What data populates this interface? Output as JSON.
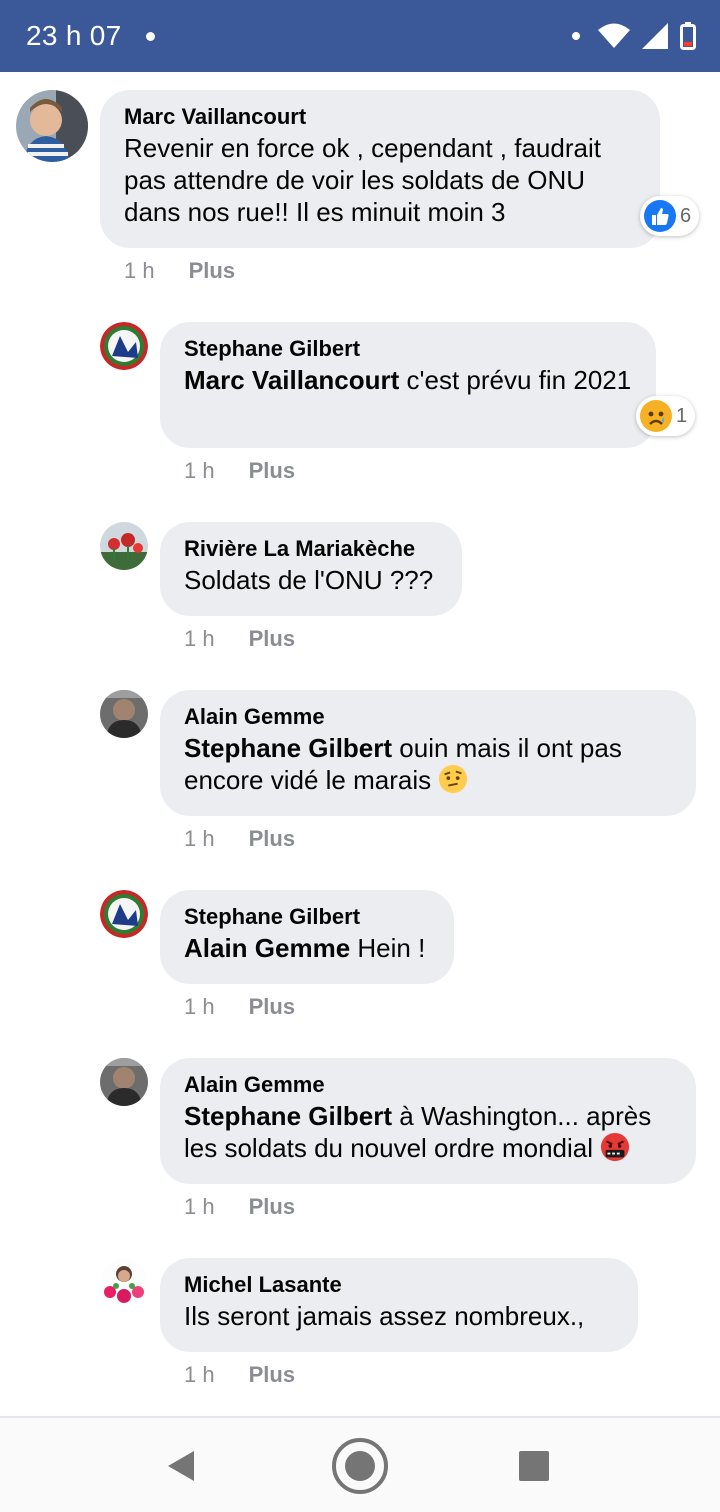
{
  "status_bar": {
    "time": "23 h 07",
    "icons": [
      "notification-dot-icon",
      "wifi-icon",
      "signal-icon",
      "battery-low-icon"
    ],
    "background": "#3b5998"
  },
  "comments": [
    {
      "author": "Marc Vaillancourt",
      "text": "Revenir en force ok , cependant , faudrait pas attendre de voir les soldats de ONU dans nos rue!! Il es minuit moin 3",
      "time": "1 h",
      "more": "Plus",
      "reaction": {
        "icon": "like-icon",
        "count": "6"
      }
    },
    {
      "author": "Stephane Gilbert",
      "mention": "Marc Vaillancourt",
      "text": " c'est prévu fin 2021",
      "time": "1 h",
      "more": "Plus",
      "reaction": {
        "icon": "sad-face-icon",
        "count": "1"
      }
    },
    {
      "author": "Rivière La Mariakèche",
      "text": "Soldats de l'ONU ???",
      "time": "1 h",
      "more": "Plus"
    },
    {
      "author": "Alain Gemme",
      "mention": "Stephane Gilbert",
      "text": " ouin mais il ont pas encore vidé le marais",
      "emoji": "raised-eyebrow-emoji-icon",
      "time": "1 h",
      "more": "Plus"
    },
    {
      "author": "Stephane Gilbert",
      "mention": "Alain Gemme",
      "text": " Hein !",
      "time": "1 h",
      "more": "Plus"
    },
    {
      "author": "Alain Gemme",
      "mention": "Stephane Gilbert",
      "text": " à Washington... après les soldats du nouvel ordre mondial",
      "emoji": "cursing-face-emoji-icon",
      "time": "1 h",
      "more": "Plus"
    },
    {
      "author": "Michel Lasante",
      "text": "Ils seront jamais assez nombreux.,",
      "time": "1 h",
      "more": "Plus"
    }
  ],
  "nav_bar": {
    "icons": [
      "back-icon",
      "home-icon",
      "recents-icon"
    ]
  }
}
